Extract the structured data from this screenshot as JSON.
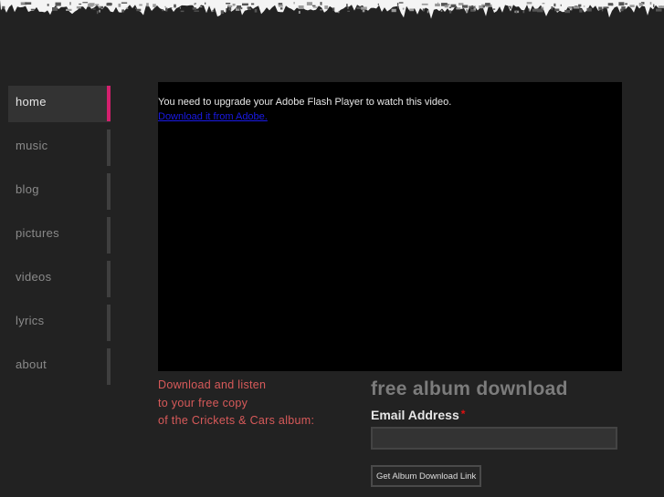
{
  "nav": {
    "items": [
      {
        "label": "home",
        "active": true
      },
      {
        "label": "music",
        "active": false
      },
      {
        "label": "blog",
        "active": false
      },
      {
        "label": "pictures",
        "active": false
      },
      {
        "label": "videos",
        "active": false
      },
      {
        "label": "lyrics",
        "active": false
      },
      {
        "label": "about",
        "active": false
      }
    ],
    "accent_color": "#d4206e"
  },
  "video": {
    "message": "You need to upgrade your Adobe Flash Player to watch this video.",
    "link_text": "Download it from Adobe."
  },
  "promo": {
    "lines": [
      "Download and listen",
      "to your free copy",
      "of the Crickets & Cars album:"
    ],
    "color": "#d85a5a"
  },
  "form": {
    "title": "free album download",
    "email_label": "Email Address",
    "required_marker": "*",
    "email_value": "",
    "email_placeholder": "",
    "submit_label": "Get Album Download Link"
  }
}
